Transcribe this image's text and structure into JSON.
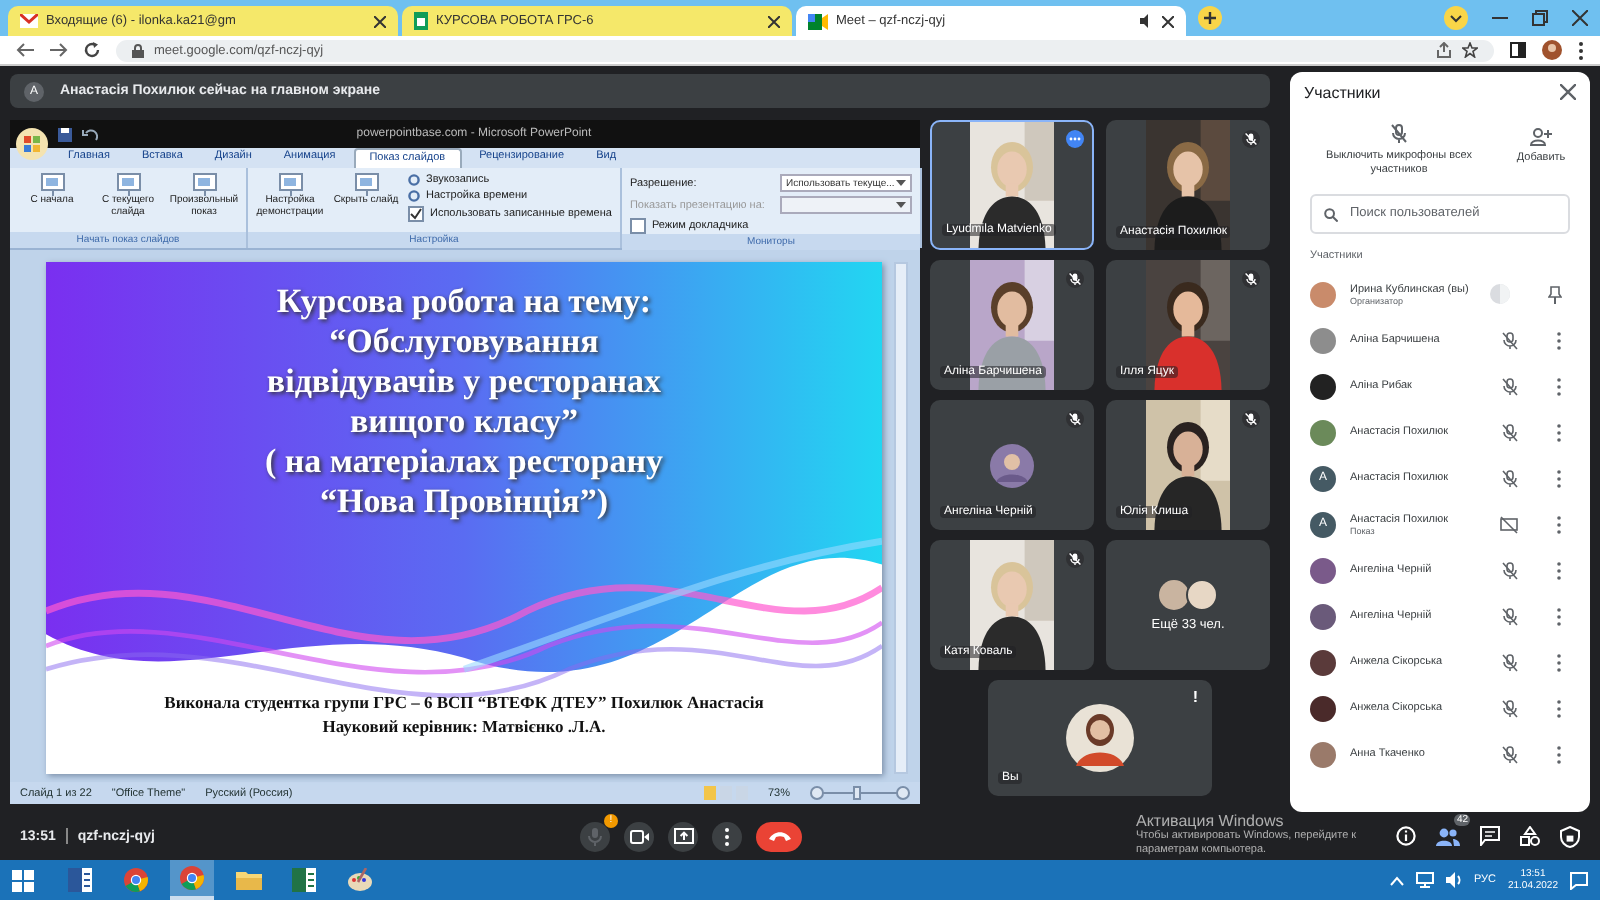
{
  "browser": {
    "tabs": [
      {
        "kind": "mail",
        "title": "Входящие (6) - ilonka.ka21@gm",
        "selected": false
      },
      {
        "kind": "sheet",
        "title": "КУРСОВА РОБОТА ГРС-6",
        "selected": false
      },
      {
        "kind": "meet",
        "title": "Meet – qzf-nczj-qyj",
        "selected": true
      }
    ],
    "url": "meet.google.com/qzf-nczj-qyj"
  },
  "banner": {
    "avatar": "A",
    "text": "Анастасія Похилюк сейчас на главном экране"
  },
  "presentation": {
    "app_title": "powerpointbase.com - Microsoft PowerPoint",
    "ribbon_tabs": [
      {
        "label": "Главная",
        "selected": false
      },
      {
        "label": "Вставка",
        "selected": false
      },
      {
        "label": "Дизайн",
        "selected": false
      },
      {
        "label": "Анимация",
        "selected": false
      },
      {
        "label": "Показ слайдов",
        "selected": true
      },
      {
        "label": "Рецензирование",
        "selected": false
      },
      {
        "label": "Вид",
        "selected": false
      }
    ],
    "groups": [
      {
        "label": "Начать показ слайдов",
        "items": [
          {
            "kind": "large",
            "label": "С начала"
          },
          {
            "kind": "large",
            "label": "С текущего слайда"
          },
          {
            "kind": "large",
            "label": "Произвольный показ"
          }
        ]
      },
      {
        "label": "Настройка",
        "items": [
          {
            "kind": "large",
            "label": "Настройка демонстрации"
          },
          {
            "kind": "large",
            "label": "Скрыть слайд"
          },
          {
            "kind": "small",
            "label": "Звукозапись"
          },
          {
            "kind": "small",
            "label": "Настройка времени"
          },
          {
            "kind": "check",
            "label": "Использовать записанные времена",
            "checked": true
          }
        ]
      },
      {
        "label": "Мониторы",
        "items": [
          {
            "kind": "select",
            "label": "Разрешение:",
            "value": "Использовать текуще...",
            "disabled": false
          },
          {
            "kind": "select",
            "label": "Показать презентацию на:",
            "disabled": true
          },
          {
            "kind": "check",
            "label": "Режим докладчика",
            "checked": false
          }
        ]
      }
    ],
    "slide": {
      "title_lines": [
        "Курсова робота на тему:",
        "“Обслуговування",
        "відвідувачів у ресторанах",
        "вищого класу”",
        "( на матеріалах ресторану",
        "“Нова Провінція”)"
      ],
      "footer_lines": [
        "Виконала студентка групи  ГРС – 6 ВСП “ВТЕФК  ДТЕУ” Похилюк Анастасія",
        "Науковий керівник: Матвієнко .Л.А."
      ]
    },
    "status": {
      "slide": "Слайд 1 из 22",
      "theme": "\"Office Theme\"",
      "language": "Русский (Россия)",
      "zoom": "73%"
    }
  },
  "tiles": [
    {
      "name": "Lyudmila Matvienko",
      "kind": "video",
      "muted": false,
      "selected": true
    },
    {
      "name": "Анастасія Похилюк",
      "kind": "video",
      "muted": true,
      "selected": false
    },
    {
      "name": "Аліна Барчишена",
      "kind": "video",
      "muted": true,
      "selected": false
    },
    {
      "name": "Ілля Яцук",
      "kind": "video",
      "muted": true,
      "selected": false
    },
    {
      "name": "Ангеліна Черній",
      "kind": "avatar",
      "muted": true,
      "selected": false
    },
    {
      "name": "Юлія Клиша",
      "kind": "video",
      "muted": true,
      "selected": false
    },
    {
      "name": "Катя Коваль",
      "kind": "video",
      "muted": true,
      "selected": false
    },
    {
      "name": "Ещё 33 чел.",
      "kind": "group",
      "muted": false,
      "selected": false
    }
  ],
  "self_tile": {
    "name": "Вы",
    "alert": "!"
  },
  "panel": {
    "title": "Участники",
    "mute_all": "Выключить микрофоны всех участников",
    "add": "Добавить",
    "search": {
      "placeholder": "Поиск пользователей"
    },
    "section": "Участники",
    "people": [
      {
        "name": "Ирина Кублинская (вы)",
        "subtitle": "Организатор",
        "kind": "host"
      },
      {
        "name": "Аліна Барчишена",
        "kind": "guest"
      },
      {
        "name": "Аліна Рибак",
        "kind": "guest"
      },
      {
        "name": "Анастасія Похилюк",
        "kind": "guest"
      },
      {
        "name": "Анастасія Похилюк",
        "avatar_letter": "A",
        "kind": "guest"
      },
      {
        "name": "Анастасія Похилюк",
        "subtitle": "Показ",
        "avatar_letter": "A",
        "kind": "presenter"
      },
      {
        "name": "Ангеліна Черній",
        "kind": "guest"
      },
      {
        "name": "Ангеліна Черній",
        "kind": "guest"
      },
      {
        "name": "Анжела Сікорська",
        "kind": "guest"
      },
      {
        "name": "Анжела Сікорська",
        "kind": "guest"
      },
      {
        "name": "Анна Ткаченко",
        "kind": "guest"
      }
    ]
  },
  "meeting": {
    "time": "13:51",
    "code": "qzf-nczj-qyj",
    "controls": [
      {
        "kind": "mic",
        "badge": "!"
      },
      {
        "kind": "camera"
      },
      {
        "kind": "present"
      },
      {
        "kind": "more"
      },
      {
        "kind": "end"
      }
    ],
    "side_controls": [
      {
        "kind": "info"
      },
      {
        "kind": "people",
        "badge": "42"
      },
      {
        "kind": "chat"
      },
      {
        "kind": "activities"
      },
      {
        "kind": "lock"
      }
    ]
  },
  "os_notice": {
    "title": "Активация Windows",
    "text": "Чтобы активировать Windows, перейдите к параметрам компьютера."
  },
  "taskbar": {
    "apps": [
      {
        "kind": "word",
        "selected": false
      },
      {
        "kind": "chrome",
        "selected": false
      },
      {
        "kind": "chrome",
        "selected": true
      },
      {
        "kind": "folder",
        "selected": false
      },
      {
        "kind": "excel",
        "selected": false
      },
      {
        "kind": "paint",
        "selected": false
      }
    ],
    "language": "РУС",
    "time": "13:51",
    "date": "21.04.2022"
  }
}
